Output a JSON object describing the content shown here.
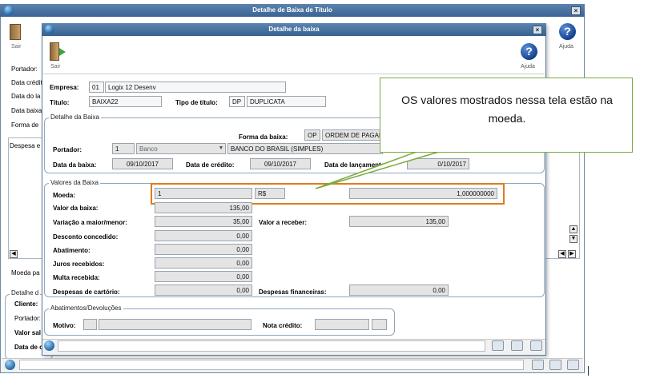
{
  "outer": {
    "title": "Detalhe de Baixa de Título",
    "close": "×",
    "left_labels": [
      "Portador:",
      "Data crédit",
      "Data do la",
      "Data baixa",
      "Forma de",
      "Despesa e"
    ],
    "sair_label": "Sair",
    "ajuda_label": "Ajuda",
    "moeda_label": "Moeda pa",
    "detalhe_label": "Detalhe d",
    "bottom_labels": [
      "Cliente:",
      "Portador:",
      "Valor sal",
      "Data de c"
    ]
  },
  "inner": {
    "title": "Detalhe da baixa",
    "close": "×",
    "sair_label": "Sair",
    "ajuda_label": "Ajuda",
    "empresa": {
      "label": "Empresa:",
      "code": "01",
      "name": "Logix 12 Desenv"
    },
    "titulo": {
      "label": "Título:",
      "value": "BAIXA22"
    },
    "tipo": {
      "label": "Tipo de título:",
      "code": "DP",
      "name": "DUPLICATA"
    },
    "detalhe": {
      "legend": "Detalhe da Baixa",
      "forma_label": "Forma da baixa:",
      "forma_code": "OP",
      "forma_name": "ORDEM DE PAGAM",
      "portador_label": "Portador:",
      "portador_code": "1",
      "portador_type": "Banco",
      "portador_name": "BANCO DO BRASIL (SIMPLES)",
      "data_baixa_label": "Data da baixa:",
      "data_baixa": "09/10/2017",
      "data_credito_label": "Data de crédito:",
      "data_credito": "09/10/2017",
      "data_lanc_label": "Data de lançamento:",
      "data_lanc": "0/10/2017"
    },
    "valores": {
      "legend": "Valores da Baixa",
      "moeda_label": "Moeda:",
      "moeda_code": "1",
      "moeda_symbol": "R$",
      "moeda_rate": "1,000000000",
      "valor_baixa_label": "Valor da baixa:",
      "valor_baixa": "135,00",
      "variacao_label": "Variação a maior/menor:",
      "variacao": "35,00",
      "valor_receber_label": "Valor a receber:",
      "valor_receber": "135,00",
      "desconto_label": "Desconto concedido:",
      "desconto": "0,00",
      "abatimento_label": "Abatimento:",
      "abatimento": "0,00",
      "juros_label": "Juros recebidos:",
      "juros": "0,00",
      "multa_label": "Multa recebida:",
      "multa": "0,00",
      "cartorio_label": "Despesas de cartório:",
      "cartorio": "0,00",
      "financeiras_label": "Despesas financeiras:",
      "financeiras": "0,00"
    },
    "abatimentos": {
      "legend": "Abatimentos/Devoluções",
      "motivo_label": "Motivo:",
      "nota_label": "Nota crédito:"
    }
  },
  "callout": {
    "text": "OS valores mostrados nessa tela estão na moeda."
  },
  "colors": {
    "titlebar": "#3e6a99",
    "callout_border": "#7aab3c",
    "highlight": "#e07b1e"
  }
}
